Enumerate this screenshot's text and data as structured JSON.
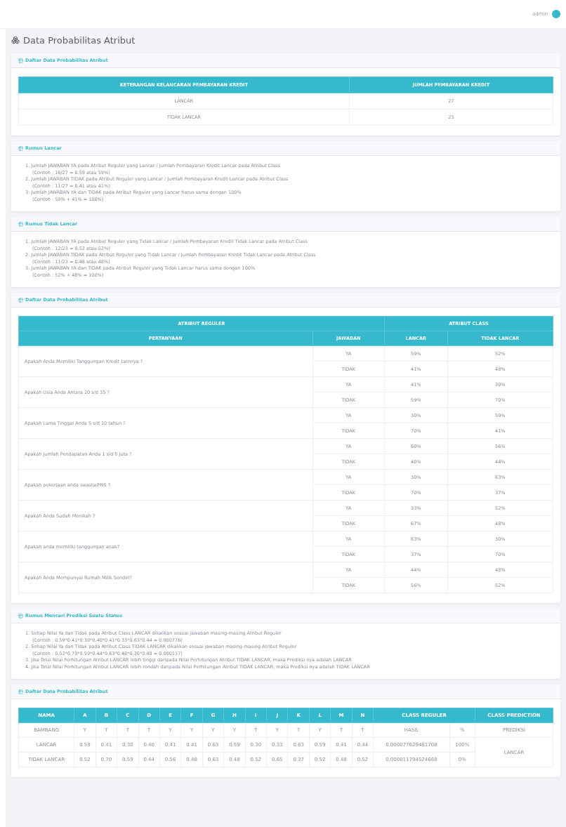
{
  "topbar": {
    "user_name": "admin"
  },
  "page_title": "Data Probabilitas Atribut",
  "count_card": {
    "title": "Daftar Data Probabilitas Atribut",
    "columns": [
      "KETERANGAN KELANCARAN PEMBAYARAN KREDIT",
      "JUMLAH PEMBAYARAN KREDIT"
    ],
    "rows": [
      {
        "status": "LANCAR",
        "count": "27"
      },
      {
        "status": "TIDAK LANCAR",
        "count": "23"
      }
    ]
  },
  "formula_lancar": {
    "title": "Rumus Lancar",
    "lines": [
      {
        "kind": "step",
        "text": "1. Jumlah JAWABAN YA pada Atribut Reguler yang Lancar / Jumlah Pembayaran Kredit Lancar pada Atribut Class"
      },
      {
        "kind": "example",
        "text": "(Contoh : 16/27 = 0.59 atau 59%)"
      },
      {
        "kind": "step",
        "text": "2. Jumlah JAWABAN TIDAK pada Atribut Reguler yang Lancar / Jumlah Pembayaran Kredit Lancar pada Atribut Class"
      },
      {
        "kind": "example",
        "text": "(Contoh : 11/27 = 0.41 atau 41%)"
      },
      {
        "kind": "step",
        "text": "3. Jumlah JAWABAN YA dan TIDAK pada Atribut Reguler yang Lancar harus sama dengan 100%"
      },
      {
        "kind": "example",
        "text": "(Contoh : 59% + 41% = 100%)"
      }
    ]
  },
  "formula_tidak_lancar": {
    "title": "Rumus Tidak Lancar",
    "lines": [
      {
        "kind": "step",
        "text": "1. Jumlah JAWABAN YA pada Atribut Reguler yang Tidak Lancar / Jumlah Pembayaran Kredit Tidak Lancar pada Atribut Class"
      },
      {
        "kind": "example",
        "text": "(Contoh : 12/23 = 0.52 atau 52%)"
      },
      {
        "kind": "step",
        "text": "2. Jumlah JAWABAN TIDAK pada Atribut Reguler yang Tidak Lancar / Jumlah Pembayaran Kredit Tidak Lancar pada Atribut Class"
      },
      {
        "kind": "example",
        "text": "(Contoh : 11/23 = 0.48 atau 48%)"
      },
      {
        "kind": "step",
        "text": "3. Jumlah JAWABAN YA dan TIDAK pada Atribut Reguler yang Tidak Lancar harus sama dengan 100%"
      },
      {
        "kind": "example",
        "text": "(Contoh : 52% + 48% = 100%)"
      }
    ]
  },
  "probability_card": {
    "title": "Daftar Data Probabilitas Atribut",
    "group_headers": [
      "ATRIBUT REGULER",
      "ATRIBUT CLASS"
    ],
    "columns": [
      "PERTANYAAN",
      "JAWABAN",
      "LANCAR",
      "TIDAK LANCAR"
    ],
    "questions": [
      {
        "text": "Apakah Anda Memiliki Tanggungan Kredit Lainnya ?",
        "answers": [
          {
            "answer": "YA",
            "lancar": "59%",
            "tidak_lancar": "52%"
          },
          {
            "answer": "TIDAK",
            "lancar": "41%",
            "tidak_lancar": "48%"
          }
        ]
      },
      {
        "text": "Apakah Usia Anda Antara 20 s/d 35 ?",
        "answers": [
          {
            "answer": "YA",
            "lancar": "41%",
            "tidak_lancar": "30%"
          },
          {
            "answer": "TIDAK",
            "lancar": "59%",
            "tidak_lancar": "70%"
          }
        ]
      },
      {
        "text": "Apakah Lama Tinggal Anda 5 s/d 10 tahun ?",
        "answers": [
          {
            "answer": "YA",
            "lancar": "30%",
            "tidak_lancar": "59%"
          },
          {
            "answer": "TIDAK",
            "lancar": "70%",
            "tidak_lancar": "41%"
          }
        ]
      },
      {
        "text": "Apakah Jumlah Pendapatan Anda 1 s/d 5 Juta ?",
        "answers": [
          {
            "answer": "YA",
            "lancar": "60%",
            "tidak_lancar": "56%"
          },
          {
            "answer": "TIDAK",
            "lancar": "40%",
            "tidak_lancar": "44%"
          }
        ]
      },
      {
        "text": "Apakah pekerjaan anda swasta/PNS ?",
        "answers": [
          {
            "answer": "YA",
            "lancar": "30%",
            "tidak_lancar": "63%"
          },
          {
            "answer": "TIDAK",
            "lancar": "70%",
            "tidak_lancar": "37%"
          }
        ]
      },
      {
        "text": "Apakah Anda Sudah Menikah ?",
        "answers": [
          {
            "answer": "YA",
            "lancar": "33%",
            "tidak_lancar": "52%"
          },
          {
            "answer": "TIDAK",
            "lancar": "67%",
            "tidak_lancar": "48%"
          }
        ]
      },
      {
        "text": "Apakah anda memiliki tanggungan anak?",
        "answers": [
          {
            "answer": "YA",
            "lancar": "63%",
            "tidak_lancar": "30%"
          },
          {
            "answer": "TIDAK",
            "lancar": "37%",
            "tidak_lancar": "70%"
          }
        ]
      },
      {
        "text": "Apakah Anda Mempunyai Rumah Milik Sendiri?",
        "answers": [
          {
            "answer": "YA",
            "lancar": "44%",
            "tidak_lancar": "48%"
          },
          {
            "answer": "TIDAK",
            "lancar": "56%",
            "tidak_lancar": "52%"
          }
        ]
      }
    ]
  },
  "prediction_formula": {
    "title": "Rumus Mencari Prediksi Suatu Status",
    "lines": [
      {
        "kind": "step",
        "text": "1. Setiap Nilai Ya dan Tidak pada Atribut Class LANCAR dikalikan sesuai jawaban masing-masing Atribut Reguler"
      },
      {
        "kind": "example",
        "text": "(Contoh : 0.59*0.41*0.30*0.40*0.41*0.33*0.63*0.44 = 0.000776)"
      },
      {
        "kind": "step",
        "text": "2. Setiap Nilai Ya dan Tidak pada Atribut Class TIDAK LANCAR dikalikan sesuai jawaban masing-masing Atribut Reguler"
      },
      {
        "kind": "example",
        "text": "(Contoh : 0.52*0.70*0.59*0.44*0.63*0.48*0.30*0.48 = 0.000117)"
      },
      {
        "kind": "step",
        "text": "3. Jika Total Nilai Perhitungan Atribut LANCAR lebih tinggi daripada Nilai Perhitungan Atribut TIDAK LANCAR, maka Prediksi nya adalah LANCAR"
      },
      {
        "kind": "step",
        "text": "4. Jika Total Nilai Perhitungan Atribut LANCAR lebih rendah daripada Nilai Perhitungan Atribut TIDAK LANCAR, maka Prediksi nya adalah TIDAK LANCAR"
      }
    ]
  },
  "prediction_card": {
    "title": "Daftar Data Probabilitas Atribut",
    "columns": [
      "NAMA",
      "A",
      "B",
      "C",
      "D",
      "E",
      "F",
      "G",
      "H",
      "I",
      "J",
      "K",
      "L",
      "M",
      "N",
      "CLASS REGULER",
      "CLASS PREDICTION"
    ],
    "input_row": {
      "name": "BAMBANG",
      "values": [
        "Y",
        "T",
        "T",
        "T",
        "Y",
        "Y",
        "Y",
        "Y",
        "T",
        "Y",
        "T",
        "Y",
        "T",
        "T"
      ],
      "class_reguler": "HASIL",
      "percent": "%",
      "prediction": "PREDIKSI"
    },
    "result_rows": [
      {
        "name": "LANCAR",
        "values": [
          "0.59",
          "0.41",
          "0.30",
          "0.40",
          "0.41",
          "0.41",
          "0.63",
          "0.59",
          "0.30",
          "0.33",
          "0.63",
          "0.59",
          "0.41",
          "0.44"
        ],
        "class_reguler": "0.000077629461708",
        "percent": "100%"
      },
      {
        "name": "TIDAK LANCAR",
        "values": [
          "0.52",
          "0.70",
          "0.59",
          "0.44",
          "0.56",
          "0.48",
          "0.63",
          "0.48",
          "0.52",
          "0.65",
          "0.37",
          "0.52",
          "0.48",
          "0.52"
        ],
        "class_reguler": "0.000011794524668",
        "percent": "0%"
      }
    ],
    "result_prediction": "LANCAR"
  }
}
